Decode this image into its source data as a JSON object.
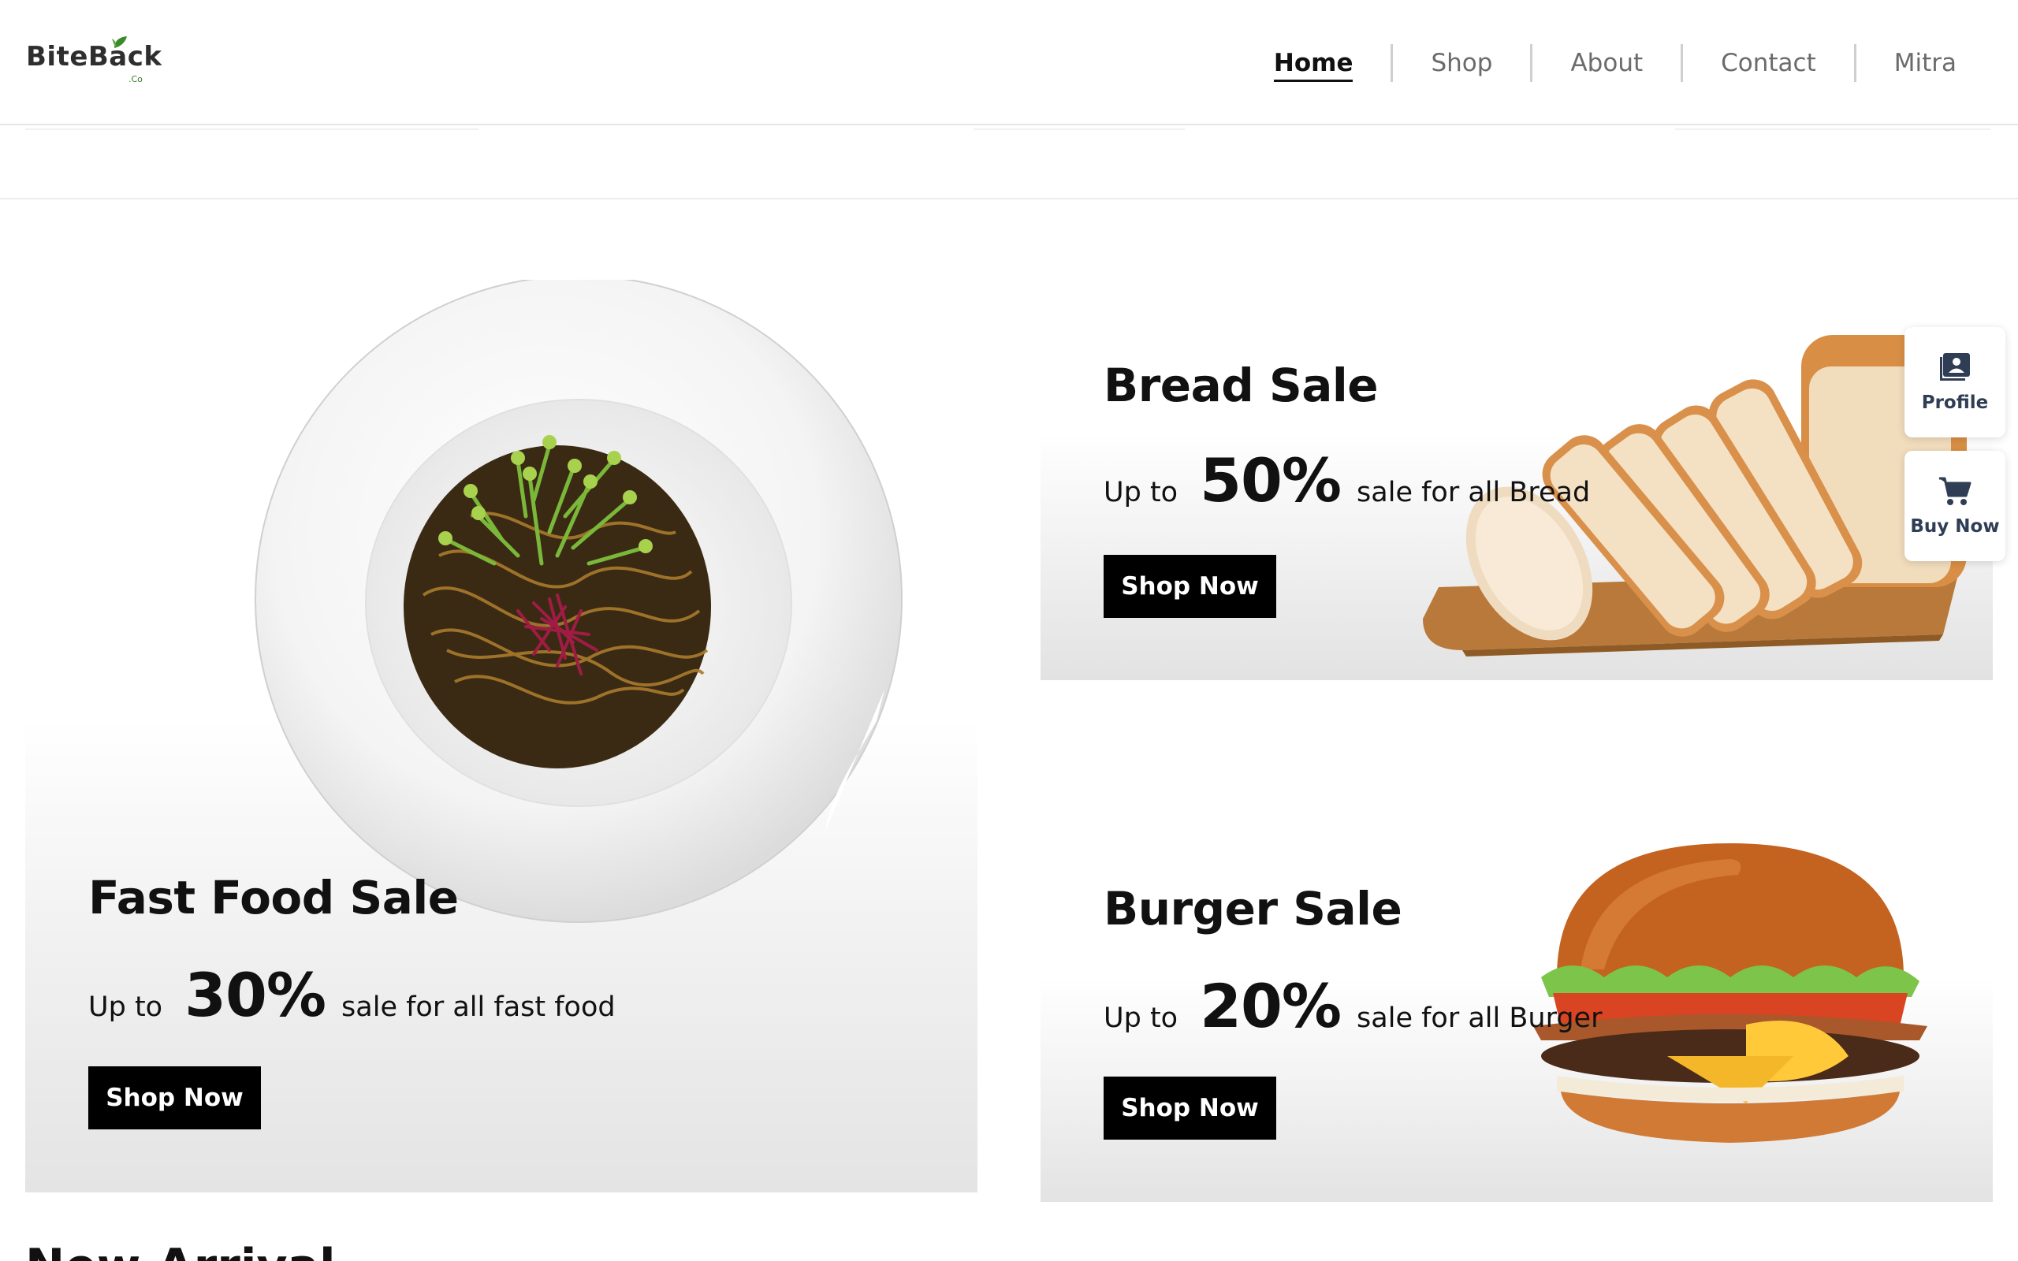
{
  "brand": {
    "name": "BiteBack",
    "suffix": ".Co"
  },
  "nav": {
    "items": [
      {
        "label": "Home",
        "active": true
      },
      {
        "label": "Shop",
        "active": false
      },
      {
        "label": "About",
        "active": false
      },
      {
        "label": "Contact",
        "active": false
      },
      {
        "label": "Mitra",
        "active": false
      }
    ]
  },
  "promos": {
    "fast_food": {
      "title": "Fast Food Sale",
      "prefix": "Up to",
      "percent": "30%",
      "suffix": "sale for all fast food",
      "button": "Shop Now",
      "image": "noodle-bowl"
    },
    "bread": {
      "title": "Bread Sale",
      "prefix": "Up to",
      "percent": "50%",
      "suffix": "sale for all Bread",
      "button": "Shop Now",
      "image": "sliced-bread-loaf"
    },
    "burger": {
      "title": "Burger Sale",
      "prefix": "Up to",
      "percent": "20%",
      "suffix": "sale for all Burger",
      "button": "Shop Now",
      "image": "cheeseburger"
    }
  },
  "floating": {
    "profile": {
      "label": "Profile",
      "icon": "profile-card-icon"
    },
    "buy": {
      "label": "Buy Now",
      "icon": "cart-icon"
    }
  },
  "next_section": {
    "title": "New Arrival"
  },
  "colors": {
    "button_bg": "#000000",
    "float_text": "#2f3e55",
    "brand_leaf": "#3a8a2c"
  }
}
